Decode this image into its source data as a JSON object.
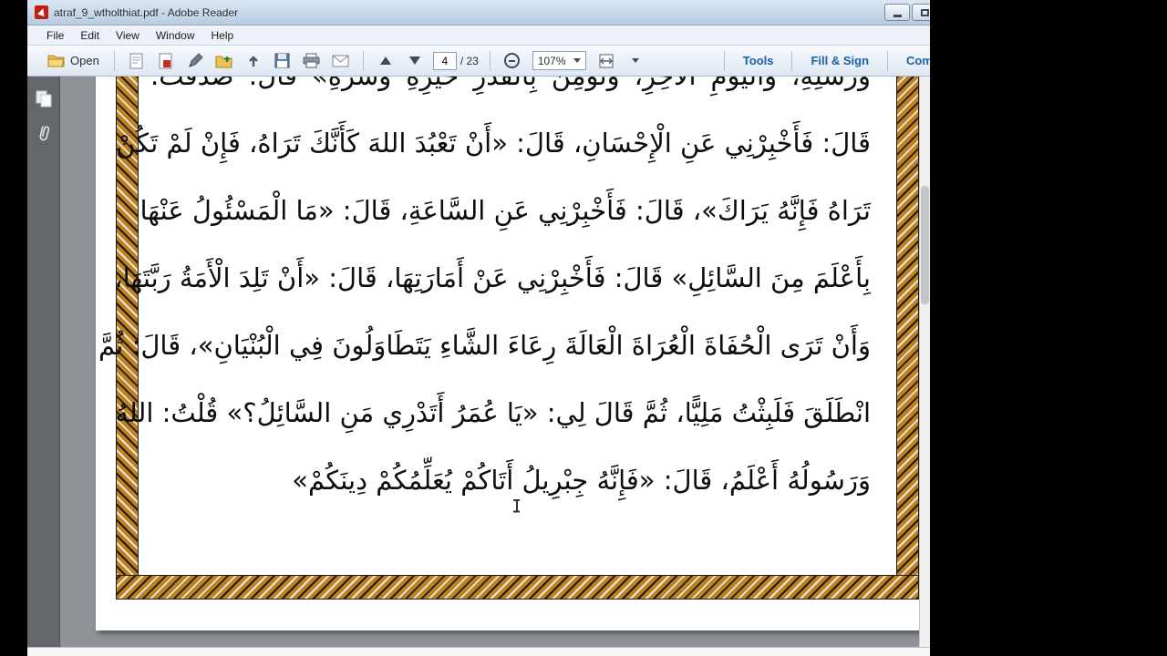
{
  "window": {
    "title": "atraf_9_wtholthiat.pdf - Adobe Reader"
  },
  "menu": {
    "items": [
      "File",
      "Edit",
      "View",
      "Window",
      "Help"
    ]
  },
  "toolbar": {
    "open_label": "Open",
    "page_current": "4",
    "page_total": "/ 23",
    "zoom_value": "107%",
    "tools_label": "Tools",
    "fill_sign_label": "Fill & Sign",
    "comment_label": "Comment",
    "icon_names": [
      "document-icon",
      "convert-pdf-icon",
      "edit-pen-icon",
      "share-folder-icon",
      "upload-icon",
      "save-icon",
      "print-icon",
      "email-icon",
      "page-up-icon",
      "page-down-icon",
      "zoom-out-icon",
      "fit-width-icon",
      "page-display-icon",
      "dropdown-caret-icon"
    ]
  },
  "sidebar": {
    "icon_names": [
      "page-thumbnails-icon",
      "attachments-paperclip-icon"
    ]
  },
  "document": {
    "lines": [
      "وَرُسُلِهِ، وَالْيَوْمِ الْآخِرِ، وَتُؤْمِنَ بِالْقَدَرِ خَيْرِهِ وَشَرِّهِ» قَالَ: صَدَقْتَ.",
      "قَالَ: فَأَخْبِرْنِي عَنِ الْإِحْسَانِ، قَالَ: «أَنْ تَعْبُدَ اللهَ كَأَنَّكَ تَرَاهُ، فَإِنْ لَمْ تَكُنْ",
      "تَرَاهُ فَإِنَّهُ يَرَاكَ»، قَالَ: فَأَخْبِرْنِي عَنِ السَّاعَةِ، قَالَ: «مَا الْمَسْئُولُ عَنْهَا",
      "بِأَعْلَمَ مِنَ السَّائِلِ» قَالَ: فَأَخْبِرْنِي عَنْ أَمَارَتِهَا، قَالَ: «أَنْ تَلِدَ الْأَمَةُ رَبَّتَهَا،",
      "وَأَنْ تَرَى الْحُفَاةَ الْعُرَاةَ الْعَالَةَ رِعَاءَ الشَّاءِ يَتَطَاوَلُونَ فِي الْبُنْيَانِ»، قَالَ: ثُمَّ",
      "انْطَلَقَ فَلَبِثْتُ مَلِيًّا، ثُمَّ قَالَ لِي: «يَا عُمَرُ أَتَدْرِي مَنِ السَّائِلُ؟» قُلْتُ: اللهُ",
      "وَرَسُولُهُ أَعْلَمُ، قَالَ: «فَإِنَّهُ جِبْرِيلُ أَتَاكُمْ يُعَلِّمُكُمْ دِينَكُمْ»"
    ]
  },
  "colors": {
    "accent_blue": "#1b5fa8",
    "ornament_orange": "#bb8124",
    "canvas_gray": "#8f9297",
    "sidebar_gray": "#63676c"
  }
}
